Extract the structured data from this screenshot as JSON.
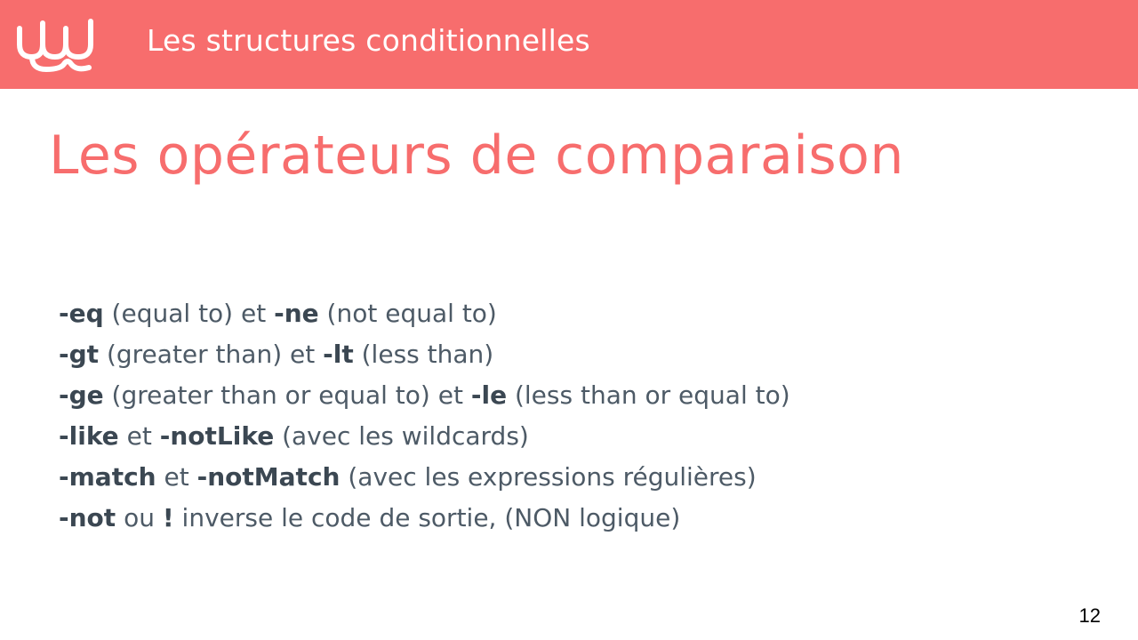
{
  "header": {
    "title": "Les structures conditionnelles",
    "logo_icon": "wave-logo-icon",
    "color": "#f76d6d"
  },
  "slide": {
    "title": "Les opérateurs de comparaison",
    "title_color": "#f76d6d",
    "page_number": "12"
  },
  "lines": [
    {
      "op1": "-eq",
      "text1": " (equal to) et ",
      "op2": "-ne",
      "text2": " (not equal to)"
    },
    {
      "op1": "-gt",
      "text1": " (greater than) et ",
      "op2": "-lt",
      "text2": " (less than)"
    },
    {
      "op1": "-ge",
      "text1": " (greater than or equal to) et ",
      "op2": "-le",
      "text2": " (less than or equal to)"
    },
    {
      "op1": "-like",
      "text1": " et ",
      "op2": "-notLike",
      "text2": " (avec les wildcards)"
    },
    {
      "op1": "-match",
      "text1": " et ",
      "op2": "-notMatch",
      "text2": " (avec les expressions régulières)"
    },
    {
      "op1": "-not",
      "text1": " ou ",
      "op2": "!",
      "text2": " inverse le code de sortie, (NON logique)"
    }
  ]
}
